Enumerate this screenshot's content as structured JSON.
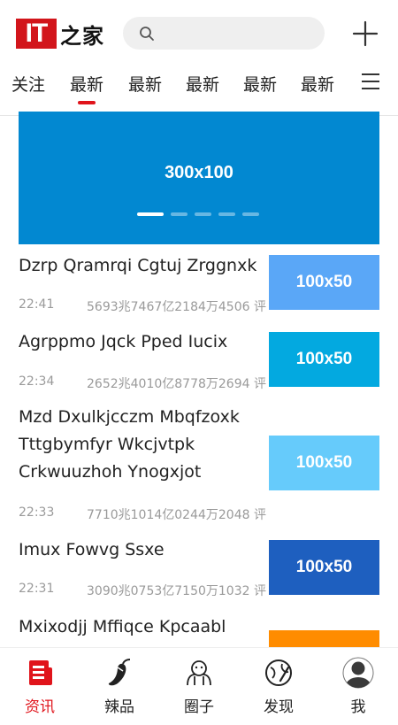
{
  "header": {
    "logo_it": "IT",
    "logo_rest": "之家",
    "search_placeholder": "",
    "icons": {
      "search": "search-icon",
      "add": "plus-icon",
      "menu": "menu-icon"
    }
  },
  "tabs": [
    {
      "label": "关注",
      "active": false
    },
    {
      "label": "最新",
      "active": true
    },
    {
      "label": "最新",
      "active": false
    },
    {
      "label": "最新",
      "active": false
    },
    {
      "label": "最新",
      "active": false
    },
    {
      "label": "最新",
      "active": false
    }
  ],
  "banner": {
    "label": "300x100",
    "color": "#0288d1",
    "slide_count": 5,
    "active_slide": 1
  },
  "articles": [
    {
      "title": "Dzrp Qramrqi Cgtuj Zrggnxk",
      "time": "22:41",
      "stats": "5693兆7467亿2184万4506 评",
      "thumb_label": "100x50",
      "thumb_color": "#5aa7f7"
    },
    {
      "title": "Agrppmo Jqck Pped Iucix",
      "time": "22:34",
      "stats": "2652兆4010亿8778万2694 评",
      "thumb_label": "100x50",
      "thumb_color": "#03a9e0"
    },
    {
      "title": "Mzd Dxulkjcczm Mbqfzoxk Tttgbymfyr Wkcjvtpk Crkwuuzhoh Ynogxjot",
      "time": "22:33",
      "stats": "7710兆1014亿0244万2048 评",
      "thumb_label": "100x50",
      "thumb_color": "#66cbfb"
    },
    {
      "title": "Imux Fowvg Ssxe",
      "time": "22:31",
      "stats": "3090兆0753亿7150万1032 评",
      "thumb_label": "100x50",
      "thumb_color": "#1e5fbf"
    },
    {
      "title": "Mxixodjj Mffiqce Kpcaabl",
      "time": "",
      "stats": "",
      "thumb_label": "",
      "thumb_color": "#ff8c00"
    }
  ],
  "bottom_nav": [
    {
      "label": "资讯",
      "icon": "news-icon",
      "active": true
    },
    {
      "label": "辣品",
      "icon": "chili-icon",
      "active": false
    },
    {
      "label": "圈子",
      "icon": "circle-group-icon",
      "active": false
    },
    {
      "label": "发现",
      "icon": "discover-planet-icon",
      "active": false
    },
    {
      "label": "我",
      "icon": "user-avatar-icon",
      "active": false
    }
  ],
  "colors": {
    "accent": "#e0141b",
    "logo_red": "#d2151b",
    "muted_text": "#9a9a9a"
  }
}
